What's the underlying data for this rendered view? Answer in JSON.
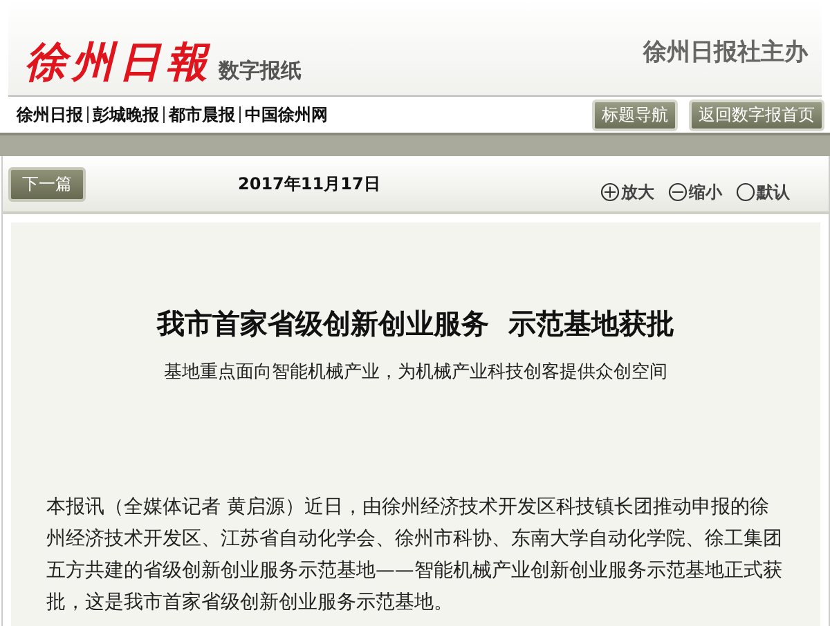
{
  "header": {
    "logo": "徐州日報",
    "subtitle": "数字报纸",
    "sponsor": "徐州日报社主办"
  },
  "nav_links": [
    "徐州日报",
    "彭城晚报",
    "都市晨报",
    "中国徐州网"
  ],
  "nav_buttons": [
    "标题导航",
    "返回数字报首页"
  ],
  "toolbar": {
    "next_button": "下一篇",
    "date": "2017年11月17日",
    "zoom": [
      {
        "kind": "plus",
        "label": "放大"
      },
      {
        "kind": "minus",
        "label": "缩小"
      },
      {
        "kind": "circle",
        "label": "默认"
      }
    ]
  },
  "article": {
    "title": "我市首家省级创新创业服务  示范基地获批",
    "subtitle": "基地重点面向智能机械产业，为机械产业科技创客提供众创空间",
    "paragraphs": [
      "本报讯（全媒体记者 黄启源）近日，由徐州经济技术开发区科技镇长团推动申报的徐州经济技术开发区、江苏省自动化学会、徐州市科协、东南大学自动化学院、徐工集团五方共建的省级创新创业服务示范基地——智能机械产业创新创业服务示范基地正式获批，这是我市首家省级创新创业服务示范基地。"
    ]
  }
}
